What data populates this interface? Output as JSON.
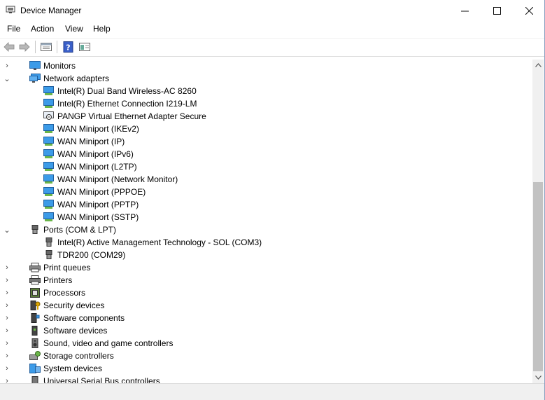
{
  "window": {
    "title": "Device Manager",
    "controls": {
      "minimize": "—",
      "maximize": "☐",
      "close": "✕"
    }
  },
  "menu": {
    "file": "File",
    "action": "Action",
    "view": "View",
    "help": "Help"
  },
  "toolbar": {
    "back": "back-icon",
    "forward": "forward-icon",
    "properties": "properties-icon",
    "help": "help-icon",
    "view": "show-hide-icon"
  },
  "tree": {
    "monitors": "Monitors",
    "network_adapters": {
      "label": "Network adapters",
      "children": [
        "Intel(R) Dual Band Wireless-AC 8260",
        "Intel(R) Ethernet Connection I219-LM",
        "PANGP Virtual Ethernet Adapter Secure",
        "WAN Miniport (IKEv2)",
        "WAN Miniport (IP)",
        "WAN Miniport (IPv6)",
        "WAN Miniport (L2TP)",
        "WAN Miniport (Network Monitor)",
        "WAN Miniport (PPPOE)",
        "WAN Miniport (PPTP)",
        "WAN Miniport (SSTP)"
      ]
    },
    "ports": {
      "label": "Ports (COM & LPT)",
      "children": [
        "Intel(R) Active Management Technology - SOL (COM3)",
        "TDR200 (COM29)"
      ]
    },
    "categories": [
      "Print queues",
      "Printers",
      "Processors",
      "Security devices",
      "Software components",
      "Software devices",
      "Sound, video and game controllers",
      "Storage controllers",
      "System devices",
      "Universal Serial Bus controllers"
    ]
  },
  "colors": {
    "accent": "#1e90ff",
    "monitor": "#3c9be8"
  }
}
